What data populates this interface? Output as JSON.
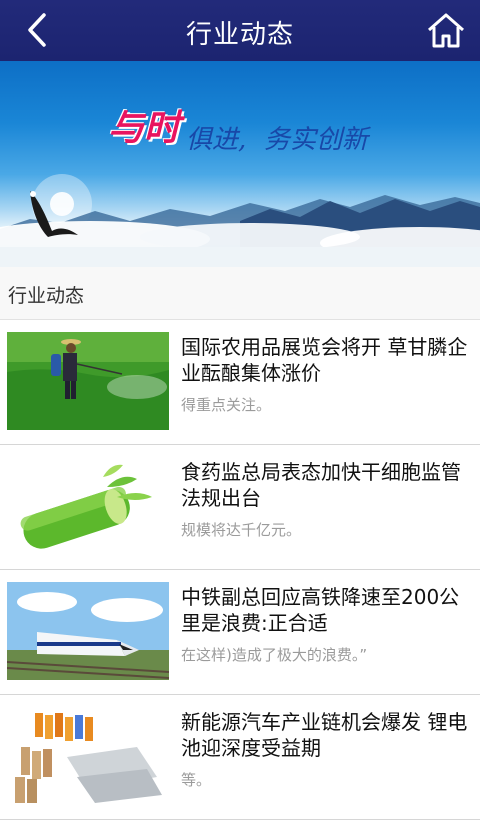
{
  "header": {
    "title": "行业动态",
    "back_icon": "chevron-left-icon",
    "home_icon": "home-icon",
    "background_color": "#222a7a"
  },
  "banner": {
    "slogan_part1": "与时",
    "slogan_part2": "俱进,",
    "slogan_part3": "务实创新"
  },
  "section": {
    "title": "行业动态"
  },
  "news": [
    {
      "headline": "国际农用品展览会将开 草甘膦企业酝酿集体涨价",
      "summary": "得重点关注。"
    },
    {
      "headline": "食药监总局表态加快干细胞监管法规出台",
      "summary": "规模将达千亿元。"
    },
    {
      "headline": "中铁副总回应高铁降速至200公里是浪费:正合适",
      "summary": "在这样)造成了极大的浪费。”"
    },
    {
      "headline": "新能源汽车产业链机会爆发 锂电池迎深度受益期",
      "summary": "等。"
    }
  ]
}
